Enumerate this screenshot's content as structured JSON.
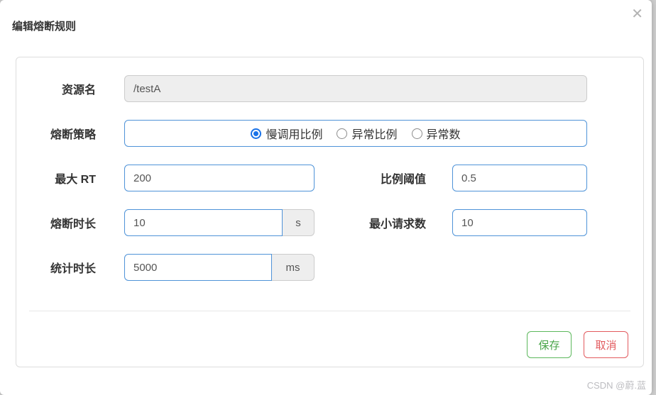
{
  "modal": {
    "title": "编辑熔断规则",
    "close_icon": "✕"
  },
  "form": {
    "resource": {
      "label": "资源名",
      "value": "/testA",
      "disabled": true
    },
    "strategy": {
      "label": "熔断策略",
      "options": [
        {
          "label": "慢调用比例",
          "selected": true
        },
        {
          "label": "异常比例",
          "selected": false
        },
        {
          "label": "异常数",
          "selected": false
        }
      ]
    },
    "max_rt": {
      "label": "最大 RT",
      "value": "200"
    },
    "ratio_threshold": {
      "label": "比例阈值",
      "value": "0.5"
    },
    "break_duration": {
      "label": "熔断时长",
      "value": "10",
      "unit": "s"
    },
    "min_requests": {
      "label": "最小请求数",
      "value": "10"
    },
    "stat_duration": {
      "label": "统计时长",
      "value": "5000",
      "unit": "ms"
    }
  },
  "footer": {
    "save_label": "保存",
    "cancel_label": "取消"
  },
  "watermark": "CSDN @蔚.蓝",
  "colors": {
    "accent_blue_border": "#4f93d8",
    "radio_checked_blue": "#1a73e8",
    "save_green": "#5cb85c",
    "cancel_red": "#e25a5e",
    "disabled_bg": "#eeeeee",
    "panel_border": "#dddddd",
    "label_text": "#333333",
    "value_text": "#555555"
  }
}
